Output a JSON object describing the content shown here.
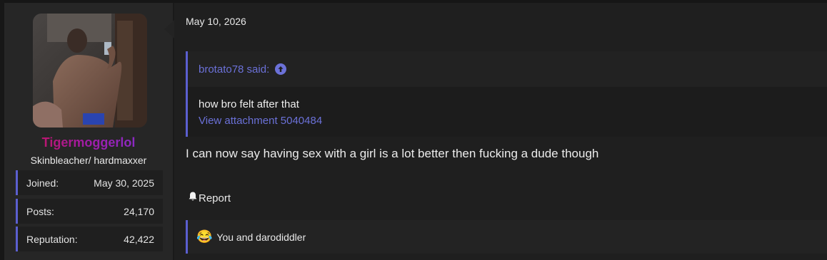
{
  "user": {
    "username": "Tigermoggerlol",
    "user_title": "Skinbleacher/ hardmaxxer",
    "stats": [
      {
        "label": "Joined:",
        "value": "May 30, 2025"
      },
      {
        "label": "Posts:",
        "value": "24,170"
      },
      {
        "label": "Reputation:",
        "value": "42,422"
      }
    ]
  },
  "post": {
    "date": "May 10, 2026",
    "quote": {
      "author_line": "brotato78 said:",
      "text": "how bro felt after that",
      "attachment_link": "View attachment 5040484"
    },
    "message": "I can now say having sex with a girl is a lot better then fucking a dude though",
    "report_label": "Report",
    "reactions_text": "You and darodiddler"
  },
  "colors": {
    "accent": "#5b5fd0",
    "link": "#6b71d8",
    "username_gradient": [
      "#d11040",
      "#7b35d8"
    ]
  }
}
